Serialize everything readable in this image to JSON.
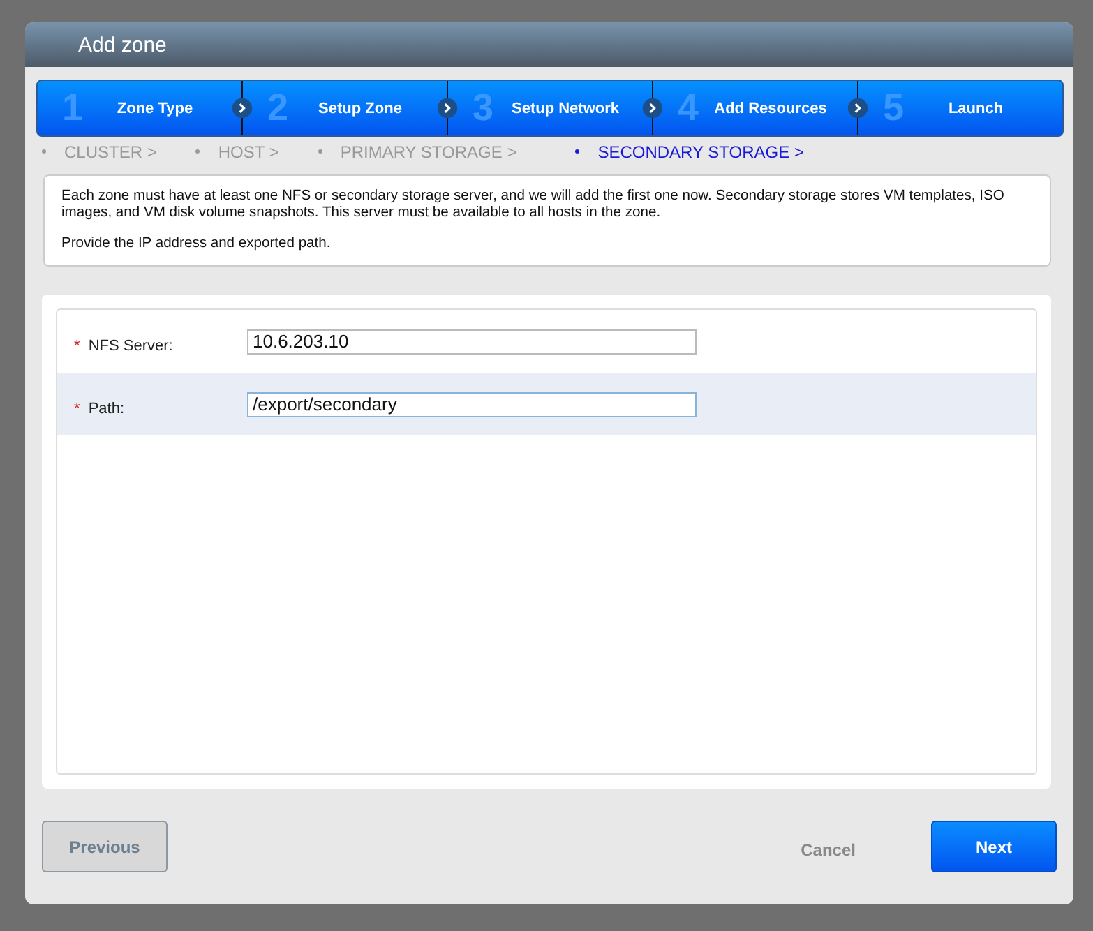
{
  "window": {
    "title": "Add zone"
  },
  "steps": [
    {
      "number": "1",
      "label": "Zone Type"
    },
    {
      "number": "2",
      "label": "Setup Zone"
    },
    {
      "number": "3",
      "label": "Setup Network"
    },
    {
      "number": "4",
      "label": "Add Resources"
    },
    {
      "number": "5",
      "label": "Launch"
    }
  ],
  "substeps": [
    {
      "label": "CLUSTER >",
      "selected": false
    },
    {
      "label": "HOST >",
      "selected": false
    },
    {
      "label": "PRIMARY STORAGE >",
      "selected": false
    },
    {
      "label": "SECONDARY STORAGE >",
      "selected": true
    }
  ],
  "description": [
    "Each zone must have at least one NFS or secondary storage server, and we will add the first one now. Secondary storage stores VM templates, ISO images, and VM disk volume snapshots. This server must be available to all hosts in the zone.",
    "Provide the IP address and exported path."
  ],
  "fields": [
    {
      "required_mark": "*",
      "label": "NFS Server:",
      "value": "10.6.203.10",
      "focused": false
    },
    {
      "required_mark": "*",
      "label": "Path:",
      "value": "/export/secondary",
      "focused": true
    }
  ],
  "buttons": {
    "previous": "Previous",
    "cancel": "Cancel",
    "next": "Next"
  }
}
